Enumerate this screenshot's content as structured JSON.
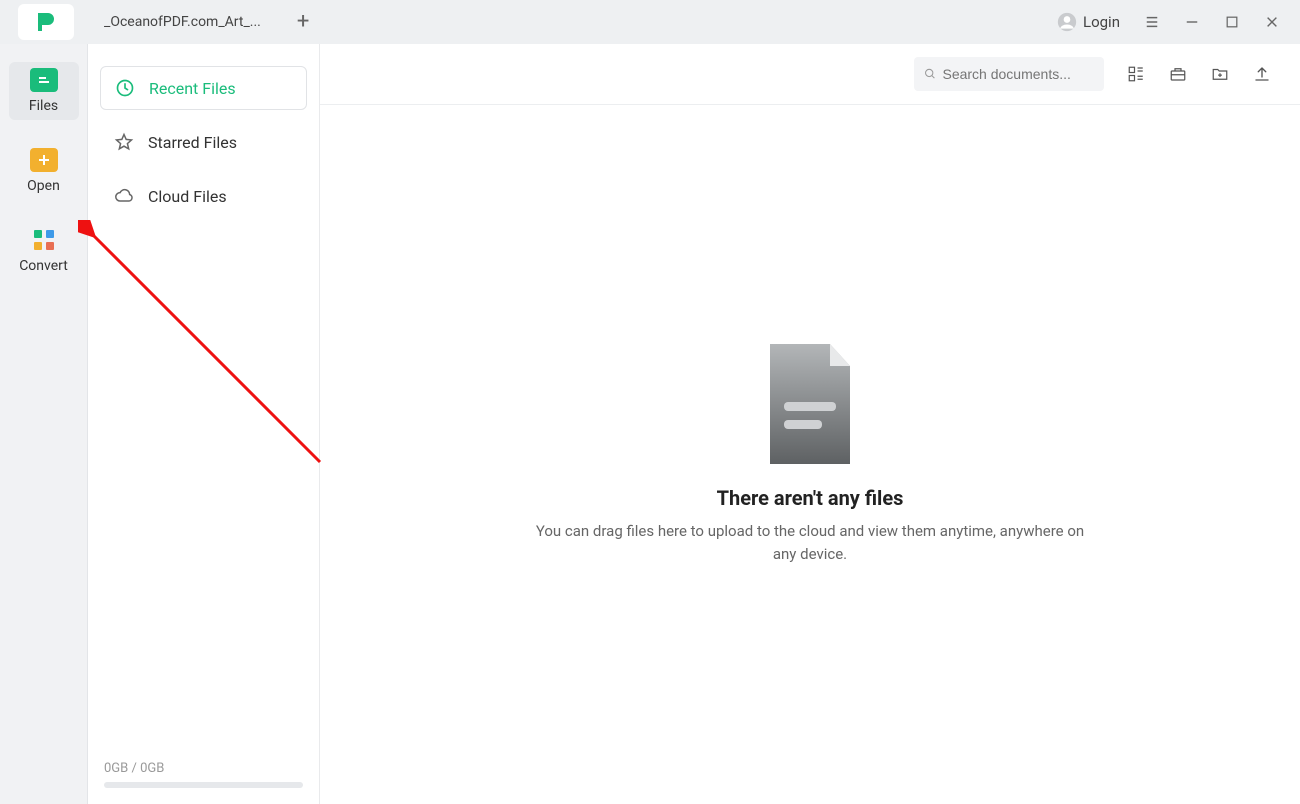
{
  "titlebar": {
    "doc_tab": "_OceanofPDF.com_Art_...",
    "login_label": "Login"
  },
  "rail": {
    "items": [
      {
        "label": "Files"
      },
      {
        "label": "Open"
      },
      {
        "label": "Convert"
      }
    ]
  },
  "nav": {
    "items": [
      {
        "label": "Recent Files"
      },
      {
        "label": "Starred Files"
      },
      {
        "label": "Cloud Files"
      }
    ],
    "storage_text": "0GB / 0GB"
  },
  "search": {
    "placeholder": "Search documents..."
  },
  "empty": {
    "title": "There aren't any files",
    "subtitle": "You can drag files here to upload to the cloud and view them anytime, anywhere on any device."
  }
}
